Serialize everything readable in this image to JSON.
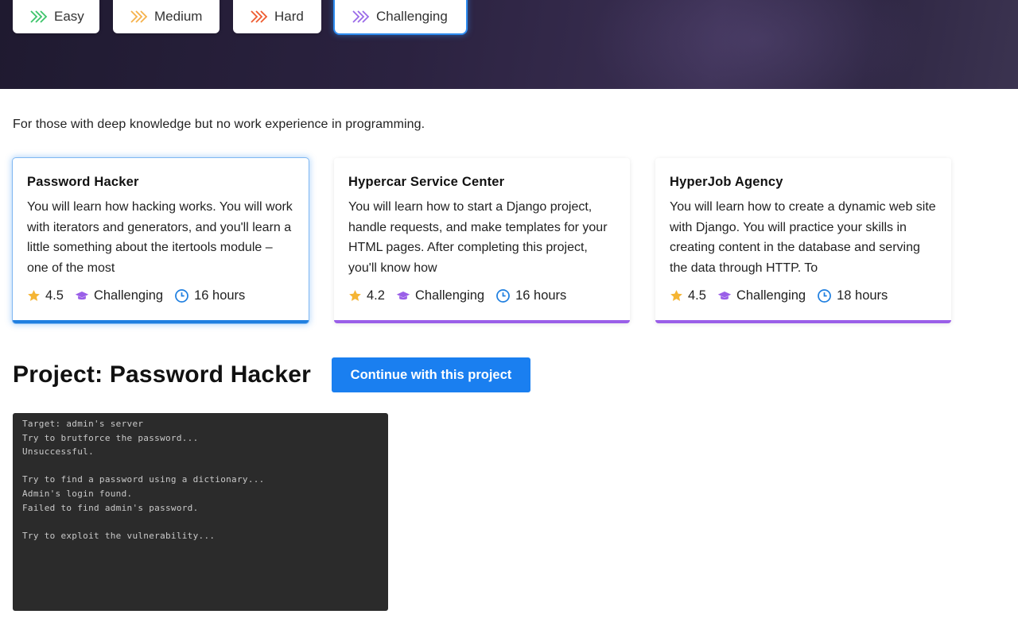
{
  "levels": {
    "tabs": [
      {
        "label": "Easy",
        "color": "#3cc46a",
        "icon": "double-chevron-right-icon"
      },
      {
        "label": "Medium",
        "color": "#f5b14a",
        "icon": "double-chevron-right-icon"
      },
      {
        "label": "Hard",
        "color": "#ee5a2f",
        "icon": "double-chevron-right-icon"
      },
      {
        "label": "Challenging",
        "color": "#9a6ae8",
        "icon": "double-chevron-right-icon",
        "selected": true
      }
    ]
  },
  "subtitle": "For those with deep knowledge but no work experience in programming.",
  "cards": [
    {
      "title": "Password Hacker",
      "description": "You will learn how hacking works. You will work with iterators and generators, and you'll learn a little something about the itertools module – one of the most",
      "rating": "4.5",
      "level": "Challenging",
      "duration": "16 hours",
      "selected": true
    },
    {
      "title": "Hypercar Service Center",
      "description": "You will learn how to start a Django project, handle requests, and make templates for your HTML pages. After completing this project, you'll know how",
      "rating": "4.2",
      "level": "Challenging",
      "duration": "16 hours"
    },
    {
      "title": "HyperJob Agency",
      "description": "You will learn how to create a dynamic web site with Django. You will practice your skills in creating content in the database and serving the data through HTTP. To",
      "rating": "4.5",
      "level": "Challenging",
      "duration": "18 hours"
    }
  ],
  "project": {
    "title": "Project: Password Hacker",
    "continue_label": "Continue with this project"
  },
  "terminal": {
    "lines": [
      "Target: admin's server",
      "Try to brutforce the password...",
      "Unsuccessful.",
      "",
      "Try to find a password using a dictionary...",
      "Admin's login found.",
      "Failed to find admin's password.",
      "",
      "Try to exploit the vulnerability..."
    ]
  },
  "colors": {
    "accent": "#1a7ff0",
    "star": "#f5b534",
    "level_icon": "#9a5fe8",
    "clock": "#1f7fe0"
  }
}
